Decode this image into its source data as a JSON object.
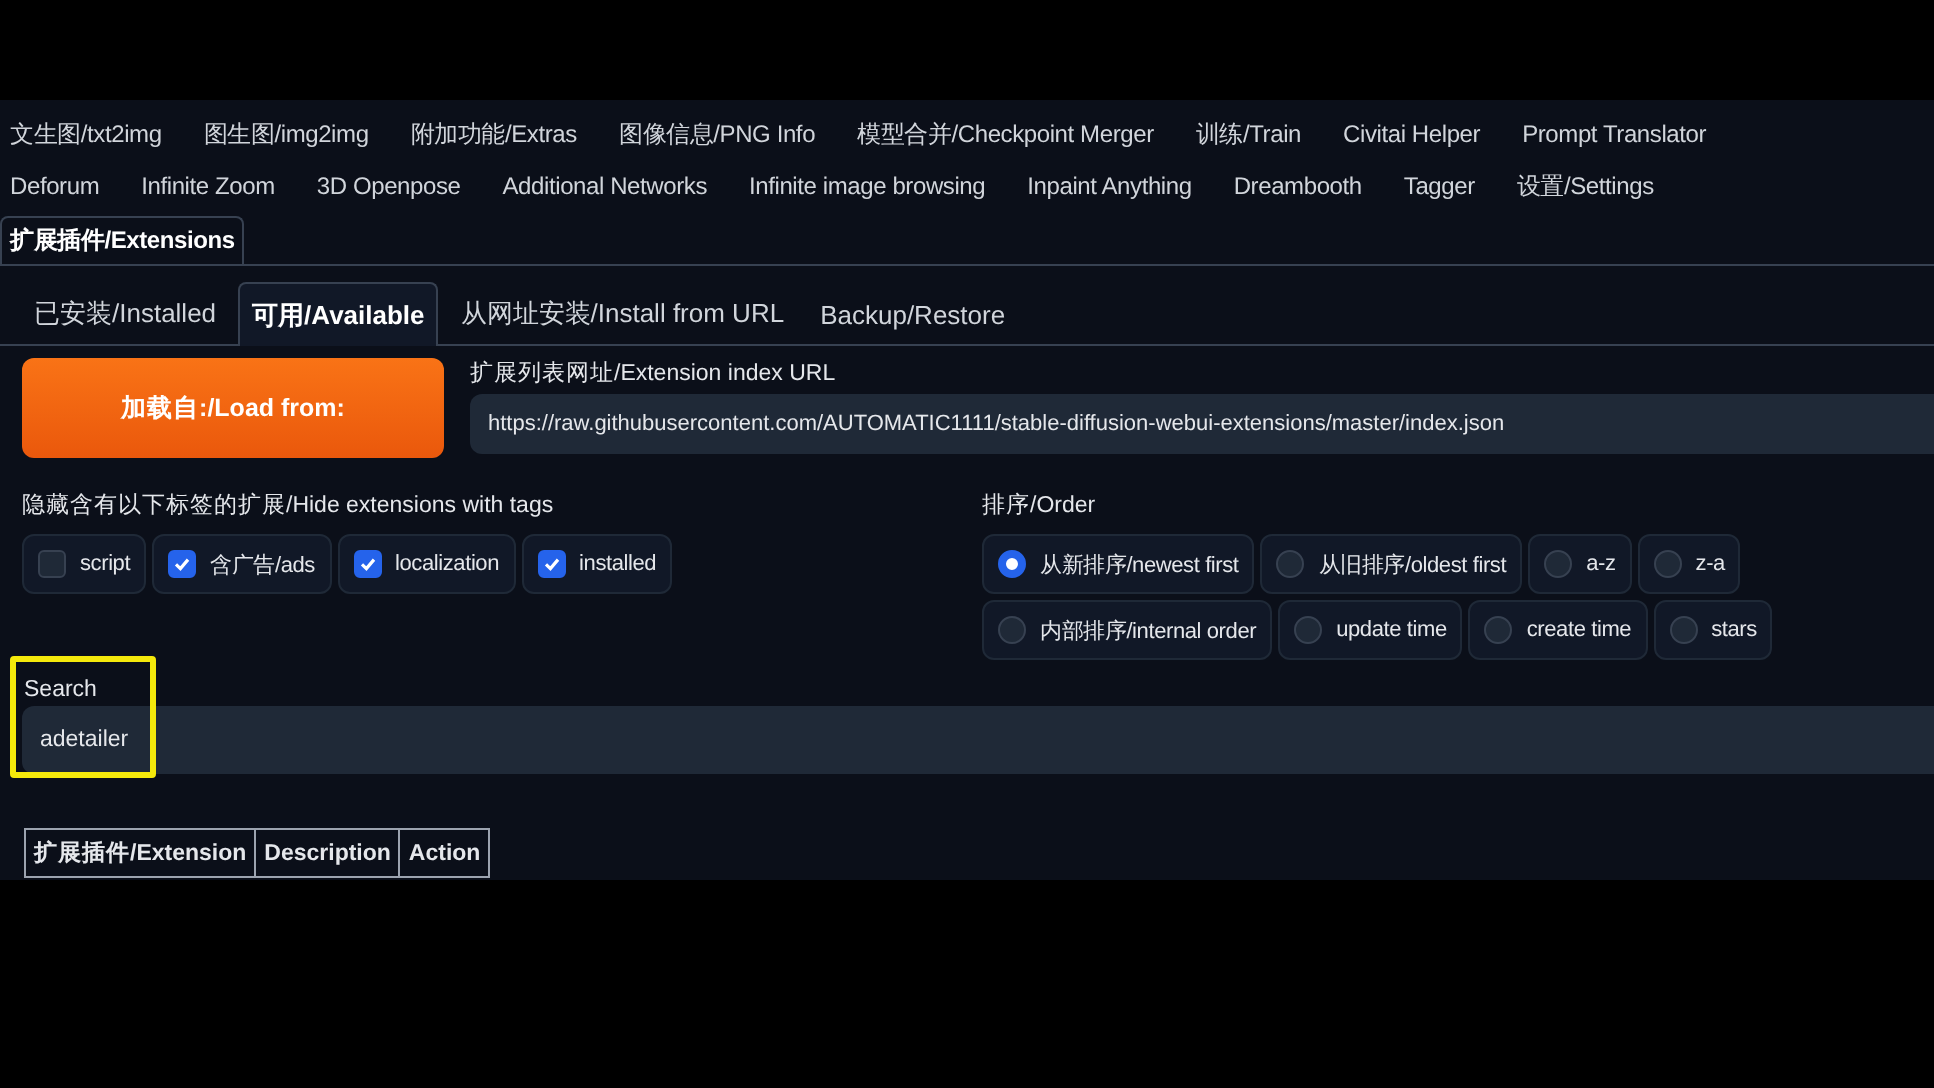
{
  "main_tab_rows": [
    {
      "tabs": [
        {
          "label": "文生图/txt2img",
          "selected": false
        },
        {
          "label": "图生图/img2img",
          "selected": false
        },
        {
          "label": "附加功能/Extras",
          "selected": false
        },
        {
          "label": "图像信息/PNG Info",
          "selected": false
        },
        {
          "label": "模型合并/Checkpoint Merger",
          "selected": false
        },
        {
          "label": "训练/Train",
          "selected": false
        },
        {
          "label": "Civitai Helper",
          "selected": false
        },
        {
          "label": "Prompt Translator",
          "selected": false
        }
      ]
    },
    {
      "tabs": [
        {
          "label": "Deforum",
          "selected": false
        },
        {
          "label": "Infinite Zoom",
          "selected": false
        },
        {
          "label": "3D Openpose",
          "selected": false
        },
        {
          "label": "Additional Networks",
          "selected": false
        },
        {
          "label": "Infinite image browsing",
          "selected": false
        },
        {
          "label": "Inpaint Anything",
          "selected": false
        },
        {
          "label": "Dreambooth",
          "selected": false
        },
        {
          "label": "Tagger",
          "selected": false
        },
        {
          "label": "设置/Settings",
          "selected": false
        }
      ]
    },
    {
      "tabs": [
        {
          "label": "扩展插件/Extensions",
          "selected": true
        }
      ]
    }
  ],
  "sub_tabs": [
    {
      "label": "已安装/Installed",
      "selected": false
    },
    {
      "label": "可用/Available",
      "selected": true
    },
    {
      "label": "从网址安装/Install from URL",
      "selected": false
    },
    {
      "label": "Backup/Restore",
      "selected": false
    }
  ],
  "load_button": "加载自:/Load from:",
  "index_url": {
    "label": "扩展列表网址/Extension index URL",
    "value": "https://raw.githubusercontent.com/AUTOMATIC1111/stable-diffusion-webui-extensions/master/index.json"
  },
  "hide_tags": {
    "label": "隐藏含有以下标签的扩展/Hide extensions with tags",
    "options": [
      {
        "label": "script",
        "checked": false
      },
      {
        "label": "含广告/ads",
        "checked": true
      },
      {
        "label": "localization",
        "checked": true
      },
      {
        "label": "installed",
        "checked": true
      }
    ]
  },
  "order": {
    "label": "排序/Order",
    "options": [
      {
        "label": "从新排序/newest first",
        "selected": true
      },
      {
        "label": "从旧排序/oldest first",
        "selected": false
      },
      {
        "label": "a-z",
        "selected": false
      },
      {
        "label": "z-a",
        "selected": false
      },
      {
        "label": "内部排序/internal order",
        "selected": false
      },
      {
        "label": "update time",
        "selected": false
      },
      {
        "label": "create time",
        "selected": false
      },
      {
        "label": "stars",
        "selected": false
      }
    ]
  },
  "search": {
    "label": "Search",
    "value": "adetailer",
    "highlighted": true
  },
  "table": {
    "columns": [
      "扩展插件/Extension",
      "Description",
      "Action"
    ]
  }
}
